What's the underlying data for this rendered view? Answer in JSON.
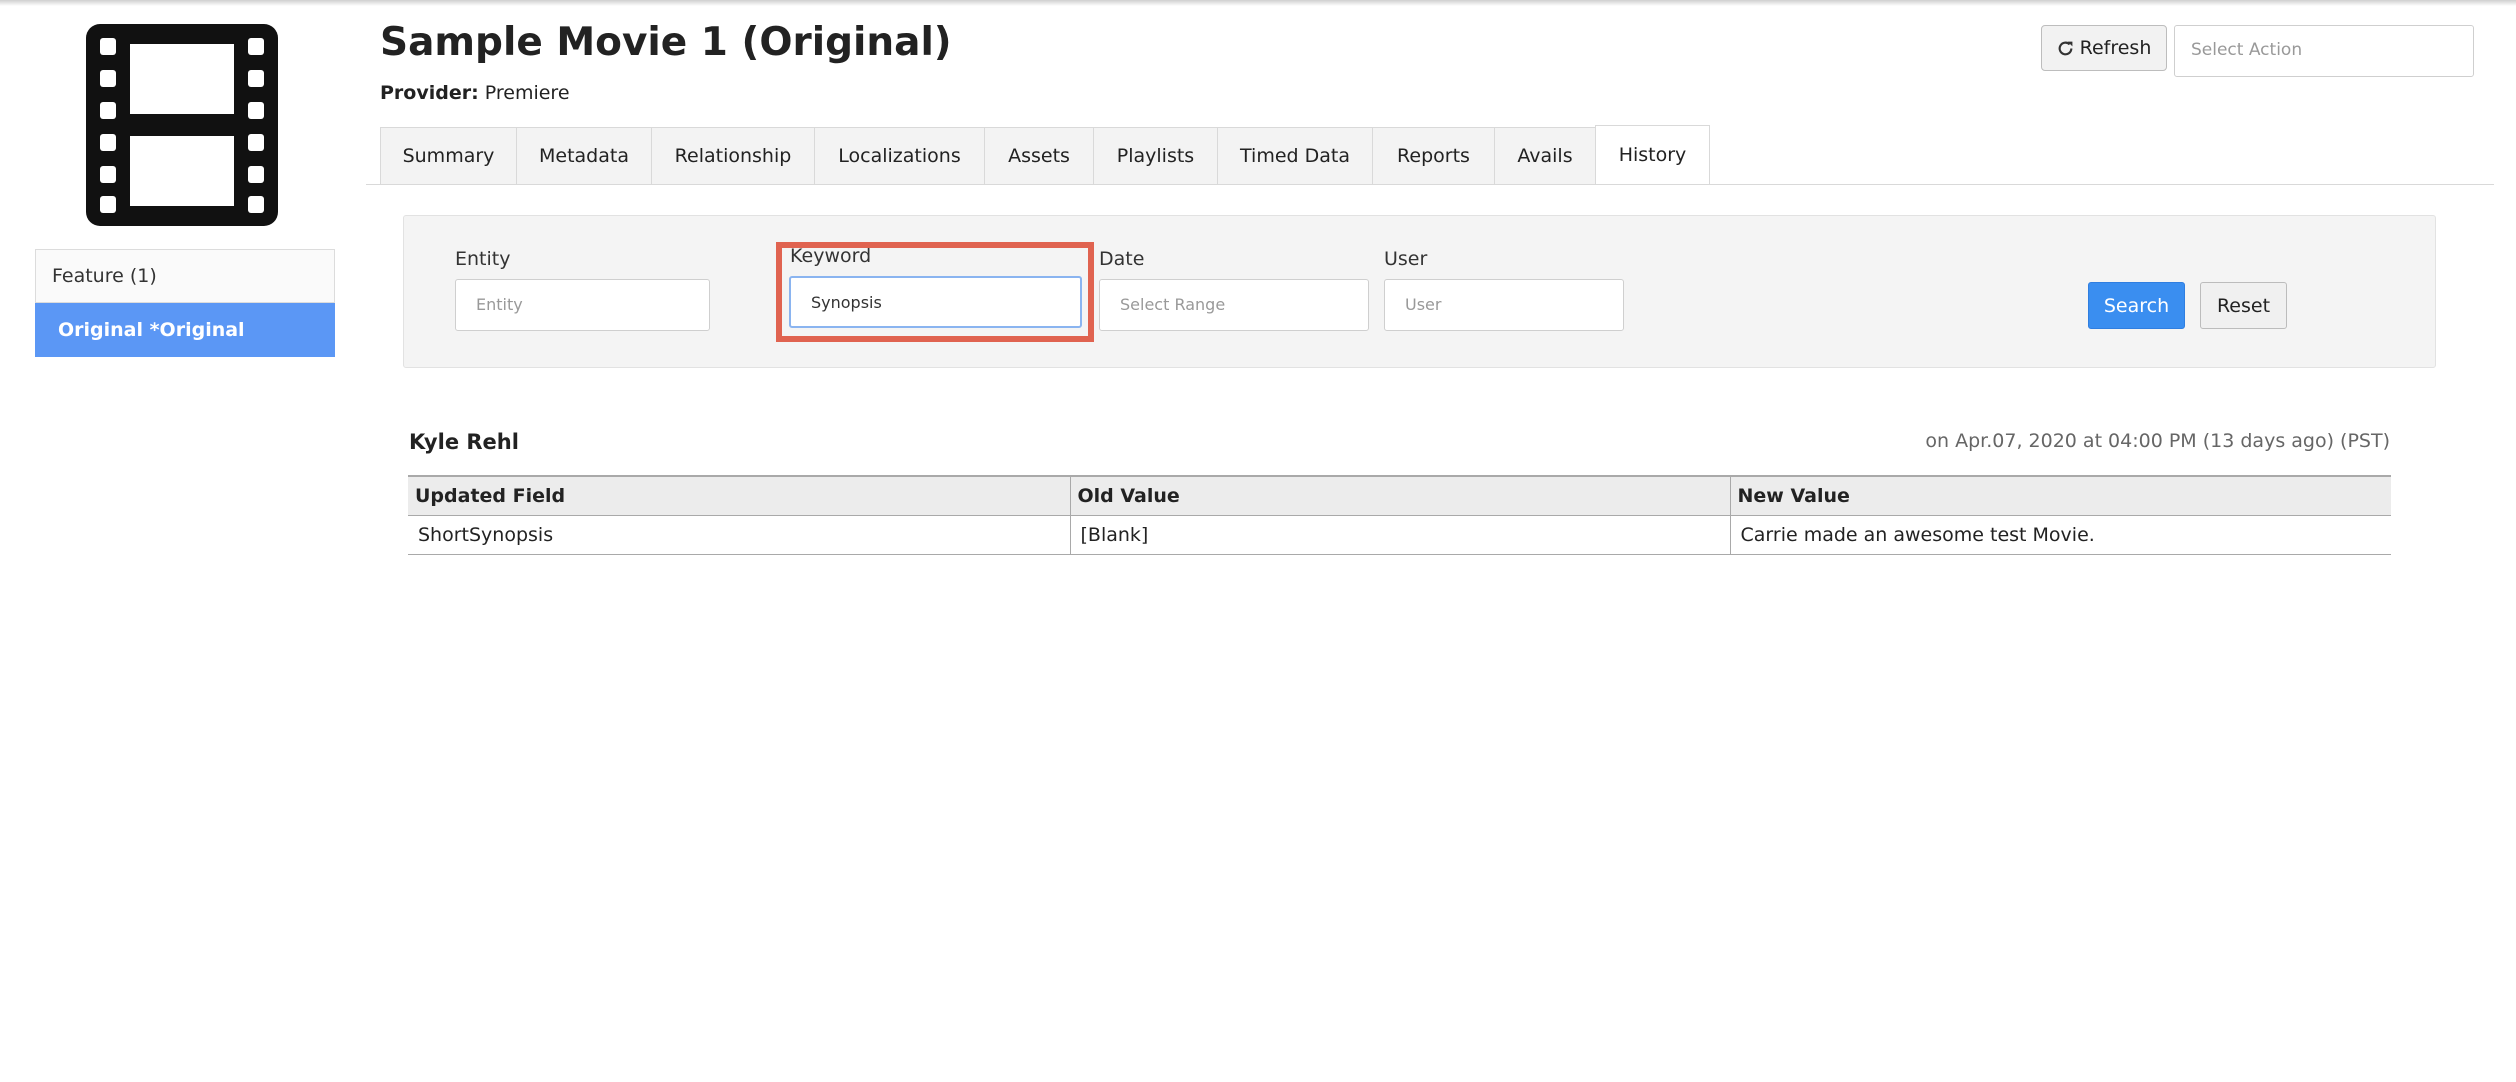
{
  "title": "Sample Movie 1 (Original)",
  "provider": {
    "label": "Provider:",
    "value": "Premiere"
  },
  "header": {
    "refresh_label": "Refresh",
    "action_placeholder": "Select Action"
  },
  "sidebar": {
    "items": [
      {
        "label": "Feature (1)",
        "active": false
      },
      {
        "label": "Original *Original",
        "active": true
      }
    ]
  },
  "tabs": [
    {
      "label": "Summary"
    },
    {
      "label": "Metadata"
    },
    {
      "label": "Relationship"
    },
    {
      "label": "Localizations"
    },
    {
      "label": "Assets"
    },
    {
      "label": "Playlists"
    },
    {
      "label": "Timed Data"
    },
    {
      "label": "Reports"
    },
    {
      "label": "Avails"
    },
    {
      "label": "History",
      "active": true
    }
  ],
  "filters": {
    "entity": {
      "label": "Entity",
      "placeholder": "Entity"
    },
    "keyword": {
      "label": "Keyword",
      "value": "Synopsis"
    },
    "date": {
      "label": "Date",
      "placeholder": "Select Range"
    },
    "user": {
      "label": "User",
      "placeholder": "User"
    },
    "search_label": "Search",
    "reset_label": "Reset"
  },
  "history": {
    "user": "Kyle Rehl",
    "timestamp": "on Apr.07, 2020 at 04:00 PM (13 days ago) (PST)",
    "columns": [
      "Updated Field",
      "Old Value",
      "New Value"
    ],
    "rows": [
      [
        "ShortSynopsis",
        "[Blank]",
        "Carrie made an awesome test Movie."
      ]
    ]
  },
  "colors": {
    "accent": "#3a8ef0",
    "sidebar_active": "#5b97f5",
    "highlight": "#e06350"
  },
  "icons": {
    "poster": "film-strip-icon",
    "refresh": "refresh-icon"
  }
}
